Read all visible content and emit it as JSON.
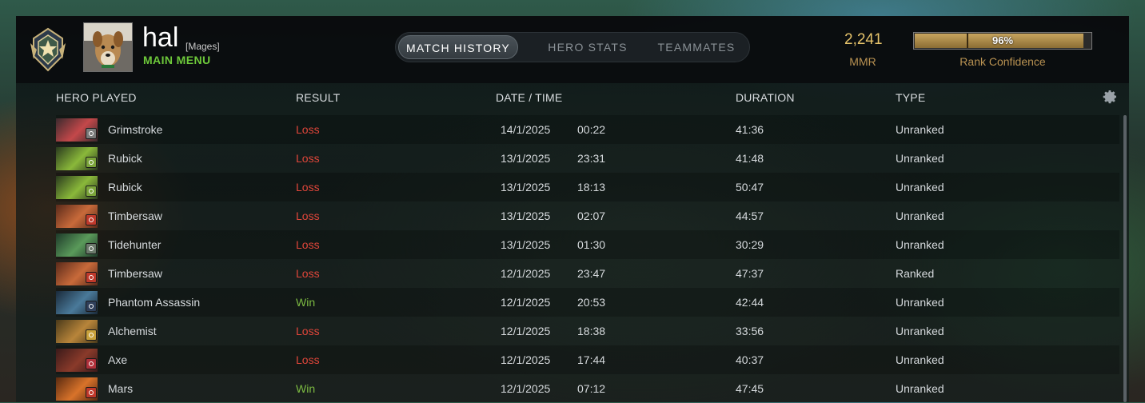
{
  "profile": {
    "username": "hal",
    "guild_tag": "[Mages]",
    "main_menu_label": "MAIN MENU"
  },
  "tabs": [
    {
      "label": "MATCH HISTORY",
      "active": true
    },
    {
      "label": "HERO STATS",
      "active": false
    },
    {
      "label": "TEAMMATES",
      "active": false
    }
  ],
  "mmr": {
    "value": "2,241",
    "label": "MMR"
  },
  "rank_confidence": {
    "percent": 96,
    "text": "96%",
    "label": "Rank Confidence"
  },
  "columns": {
    "hero": "HERO PLAYED",
    "result": "RESULT",
    "datetime": "DATE / TIME",
    "duration": "DURATION",
    "type": "TYPE"
  },
  "colors": {
    "loss": "#e0463a",
    "win": "#7dbb42",
    "gold": "#e6c36b",
    "accent_green": "#6dc83a"
  },
  "matches": [
    {
      "hero": "Grimstroke",
      "result": "Loss",
      "date": "14/1/2025",
      "time": "00:22",
      "duration": "41:36",
      "type": "Unranked",
      "icon": "grimstroke-portrait",
      "colors": [
        "#3b2a2e",
        "#c4484a"
      ],
      "badge": "#7a7a7a"
    },
    {
      "hero": "Rubick",
      "result": "Loss",
      "date": "13/1/2025",
      "time": "23:31",
      "duration": "41:48",
      "type": "Unranked",
      "icon": "rubick-portrait",
      "colors": [
        "#2a3a1e",
        "#8ab83a"
      ],
      "badge": "#7ba43a"
    },
    {
      "hero": "Rubick",
      "result": "Loss",
      "date": "13/1/2025",
      "time": "18:13",
      "duration": "50:47",
      "type": "Unranked",
      "icon": "rubick-portrait",
      "colors": [
        "#2a3a1e",
        "#8ab83a"
      ],
      "badge": "#7ba43a"
    },
    {
      "hero": "Timbersaw",
      "result": "Loss",
      "date": "13/1/2025",
      "time": "02:07",
      "duration": "44:57",
      "type": "Unranked",
      "icon": "timbersaw-portrait",
      "colors": [
        "#5a2a1a",
        "#c86a3a"
      ],
      "badge": "#c0392b"
    },
    {
      "hero": "Tidehunter",
      "result": "Loss",
      "date": "13/1/2025",
      "time": "01:30",
      "duration": "30:29",
      "type": "Unranked",
      "icon": "tidehunter-portrait",
      "colors": [
        "#1e3a2a",
        "#5a9a5a"
      ],
      "badge": "#6b7a6b"
    },
    {
      "hero": "Timbersaw",
      "result": "Loss",
      "date": "12/1/2025",
      "time": "23:47",
      "duration": "47:37",
      "type": "Ranked",
      "icon": "timbersaw-portrait",
      "colors": [
        "#5a2a1a",
        "#c86a3a"
      ],
      "badge": "#c0392b"
    },
    {
      "hero": "Phantom Assassin",
      "result": "Win",
      "date": "12/1/2025",
      "time": "20:53",
      "duration": "42:44",
      "type": "Unranked",
      "icon": "phantom-assassin-portrait",
      "colors": [
        "#1a2a3a",
        "#4a7a9a"
      ],
      "badge": "#2f3f5a"
    },
    {
      "hero": "Alchemist",
      "result": "Loss",
      "date": "12/1/2025",
      "time": "18:38",
      "duration": "33:56",
      "type": "Unranked",
      "icon": "alchemist-portrait",
      "colors": [
        "#4a3a1a",
        "#b8853a"
      ],
      "badge": "#c9a13a"
    },
    {
      "hero": "Axe",
      "result": "Loss",
      "date": "12/1/2025",
      "time": "17:44",
      "duration": "40:37",
      "type": "Unranked",
      "icon": "axe-portrait",
      "colors": [
        "#3a1a1a",
        "#8a3a2a"
      ],
      "badge": "#b0303a"
    },
    {
      "hero": "Mars",
      "result": "Win",
      "date": "12/1/2025",
      "time": "07:12",
      "duration": "47:45",
      "type": "Unranked",
      "icon": "mars-portrait",
      "colors": [
        "#5a2a10",
        "#d8732a"
      ],
      "badge": "#c0392b"
    }
  ]
}
